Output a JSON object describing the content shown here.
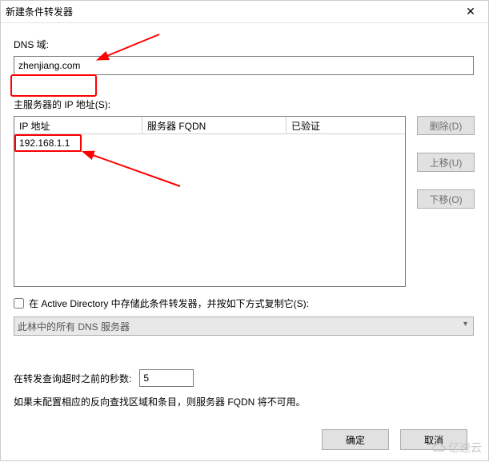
{
  "dialog": {
    "title": "新建条件转发器",
    "close_label": "✕"
  },
  "dns": {
    "label": "DNS 域:",
    "value": "zhenjiang.com"
  },
  "master": {
    "label": "主服务器的 IP 地址(S):",
    "columns": {
      "ip": "IP 地址",
      "fqdn": "服务器 FQDN",
      "validated": "已验证"
    },
    "rows": [
      {
        "ip": "192.168.1.1",
        "fqdn": "",
        "validated": ""
      }
    ]
  },
  "side_buttons": {
    "delete": "删除(D)",
    "move_up": "上移(U)",
    "move_down": "下移(O)"
  },
  "store": {
    "checkbox_label": "在 Active Directory 中存储此条件转发器，并按如下方式复制它(S):",
    "replication_option": "此林中的所有 DNS 服务器"
  },
  "timeout": {
    "label": "在转发查询超时之前的秒数:",
    "value": "5"
  },
  "note": "如果未配置相应的反向查找区域和条目，则服务器 FQDN 将不可用。",
  "footer": {
    "ok": "确定",
    "cancel": "取消"
  },
  "watermark": "亿速云"
}
